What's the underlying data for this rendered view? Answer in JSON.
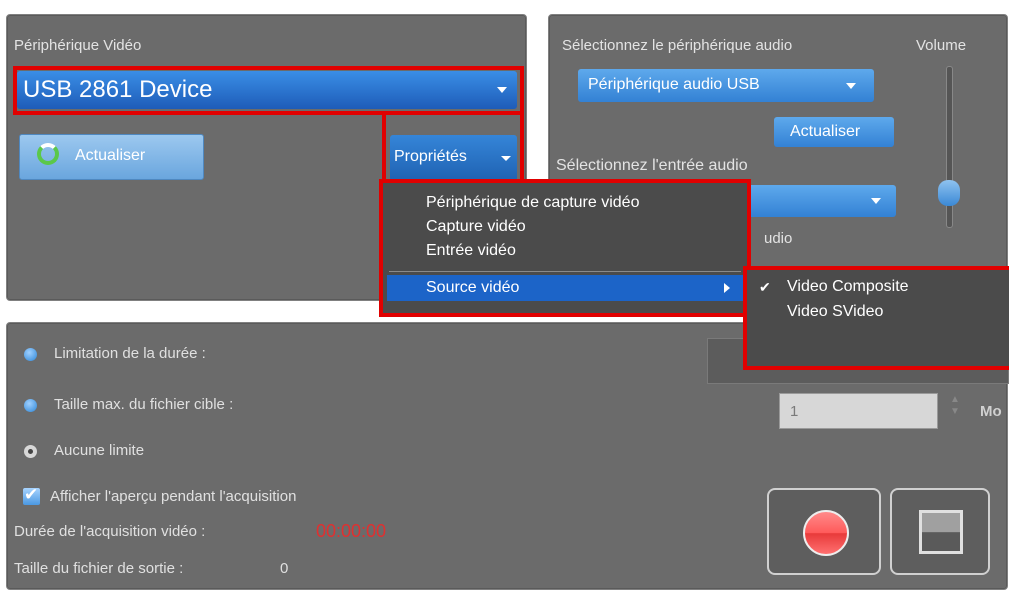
{
  "video": {
    "section_label": "Périphérique Vidéo",
    "device_selected": "USB 2861 Device",
    "refresh_label": "Actualiser",
    "properties_label": "Propriétés"
  },
  "properties_menu": {
    "items": [
      "Périphérique de capture vidéo",
      "Capture vidéo",
      "Entrée vidéo",
      "Source vidéo"
    ]
  },
  "source_submenu": {
    "items": [
      "Video Composite",
      "Video SVideo"
    ],
    "checked": "Video Composite"
  },
  "audio": {
    "select_device_label": "Sélectionnez le périphérique audio",
    "device_selected": "Périphérique audio USB",
    "volume_label": "Volume",
    "refresh_label": "Actualiser",
    "select_input_label": "Sélectionnez l'entrée audio",
    "partial_text": "udio",
    "volume_level": 0.15
  },
  "options": {
    "duration_limit_label": "Limitation de la durée :",
    "max_size_label": "Taille max. du fichier cible :",
    "max_size_value": "1",
    "max_size_unit": "Mo",
    "no_limit_label": "Aucune limite",
    "preview_label": "Afficher l'aperçu pendant l'acquisition",
    "capture_duration_label": "Durée de l'acquisition vidéo :",
    "capture_duration_value": "00:00:00",
    "output_size_label": "Taille du fichier de sortie :",
    "output_size_value": "0"
  },
  "colors": {
    "panel": "#6b6b6b",
    "accent_blue": "#2f7fd0",
    "highlight_red": "#e00000",
    "timer_red": "#e03030",
    "menu_highlight": "#1c64c8"
  }
}
